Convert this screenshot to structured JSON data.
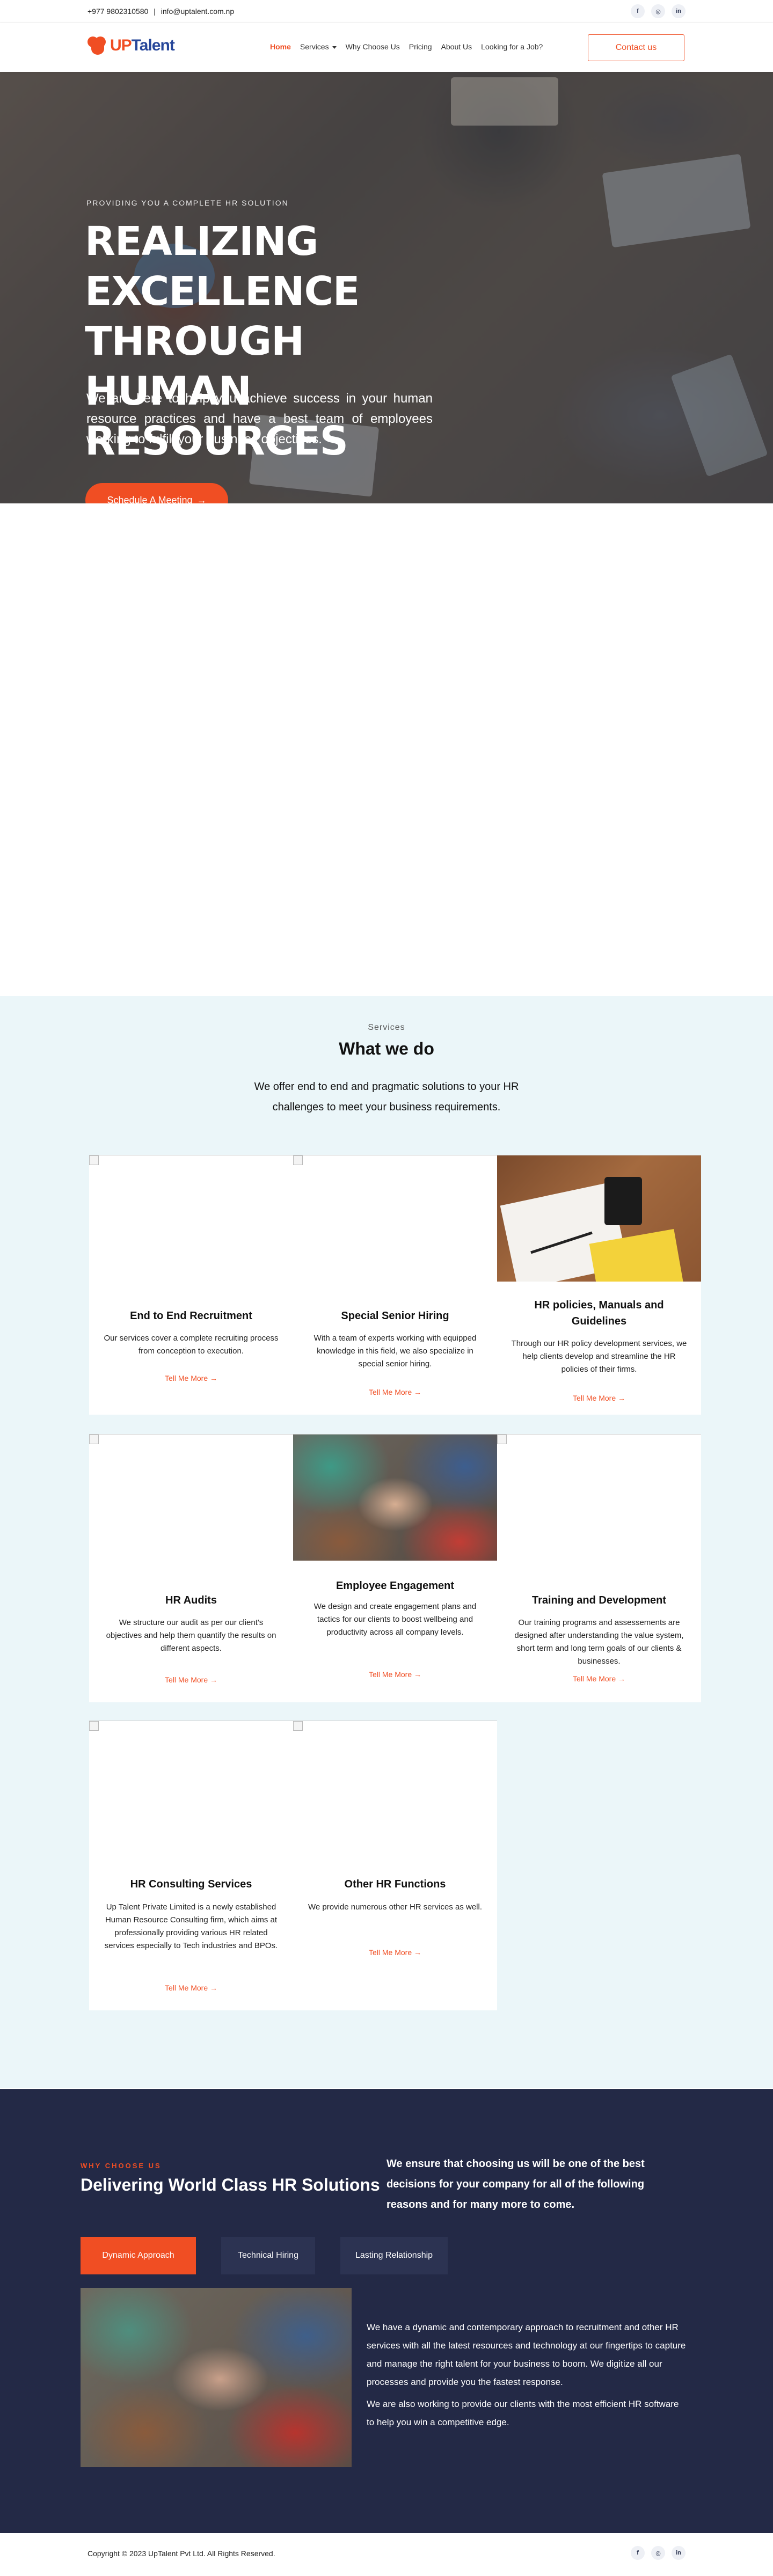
{
  "topbar": {
    "phone": "+977 9802310580",
    "separator": "|",
    "email": "info@uptalent.com.np",
    "socials": [
      {
        "icon": "facebook-icon",
        "glyph": "f"
      },
      {
        "icon": "instagram-icon",
        "glyph": "◎"
      },
      {
        "icon": "linkedin-icon",
        "glyph": "in"
      }
    ]
  },
  "header": {
    "logo_prefix": "U",
    "logo_accent": "P",
    "logo_rest": "Talent",
    "nav": [
      {
        "label": "Home",
        "active": true
      },
      {
        "label": "Services",
        "dropdown": true
      },
      {
        "label": "Why Choose Us"
      },
      {
        "label": "Pricing"
      },
      {
        "label": "About Us"
      },
      {
        "label": "Looking for a Job?"
      }
    ],
    "contact_label": "Contact us"
  },
  "hero": {
    "kicker": "PROVIDING YOU A COMPLETE HR SOLUTION",
    "title": "Realizing Excellence Through Human Resources",
    "text": "We are here to help you achieve success in your human resource practices and have a best team of employees working to fulfill your business objectives.",
    "cta": "Schedule A Meeting",
    "cta_icon": "→"
  },
  "services": {
    "kicker": "Services",
    "title": "What we do",
    "intro": "We offer end to end and pragmatic solutions to your HR challenges to meet your business requirements.",
    "more_label": "Tell Me More",
    "more_icon": "→",
    "cards": [
      {
        "title": "End to End Recruitment",
        "text": "Our services cover a complete recruiting process from conception to execution.",
        "image": "broken"
      },
      {
        "title": "Special Senior Hiring",
        "text": "With a team of experts working with equipped knowledge in this field, we also specialize in special senior hiring.",
        "image": "broken"
      },
      {
        "title": "HR policies, Manuals and Guidelines",
        "text": "Through our HR policy development services, we help clients develop and streamline the HR policies of their firms.",
        "image": "desk-mug-photo"
      },
      {
        "title": "HR Audits",
        "text": "We structure our audit as per our client's objectives and help them quantify the results on different aspects.",
        "image": "broken"
      },
      {
        "title": "Employee Engagement",
        "text": "We design and create engagement plans and tactics for our clients to boost wellbeing and productivity across all company levels.",
        "image": "hands-together-photo"
      },
      {
        "title": "Training and Development",
        "text": "Our training programs and assessements are designed after understanding the value system, short term and long term goals of our clients & businesses.",
        "image": "broken"
      },
      {
        "title": "HR Consulting Services",
        "text": "Up Talent Private Limited is a newly established Human Resource Consulting firm, which aims at professionally providing various HR related services especially to Tech industries and BPOs.",
        "image": "broken"
      },
      {
        "title": "Other HR Functions",
        "text": "We provide numerous other HR services as well.",
        "image": "broken"
      }
    ]
  },
  "why": {
    "kicker": "WHY CHOOSE US",
    "title": "Delivering World Class HR Solutions",
    "lead": "We ensure that choosing us will be one of the best decisions for your company for all of the following reasons and for many more to come.",
    "tabs": [
      {
        "label": "Dynamic Approach",
        "active": true
      },
      {
        "label": "Technical Hiring"
      },
      {
        "label": "Lasting Relationship"
      }
    ],
    "paragraphs": [
      "We have a dynamic and contemporary approach to recruitment and other HR services with all the latest resources and technology at our fingertips to capture and manage the right talent for your business to boom. We digitize all our processes and provide you the fastest response.",
      "We are also working to provide our clients with the most efficient HR software to help you win a competitive edge."
    ]
  },
  "footer": {
    "copyright": "Copyright © 2023 UpTalent Pvt Ltd. All Rights Reserved."
  },
  "colors": {
    "accent": "#f04e23",
    "brand_blue": "#27479a",
    "dark_bg": "#232946",
    "light_bg": "#ebf6f9"
  }
}
